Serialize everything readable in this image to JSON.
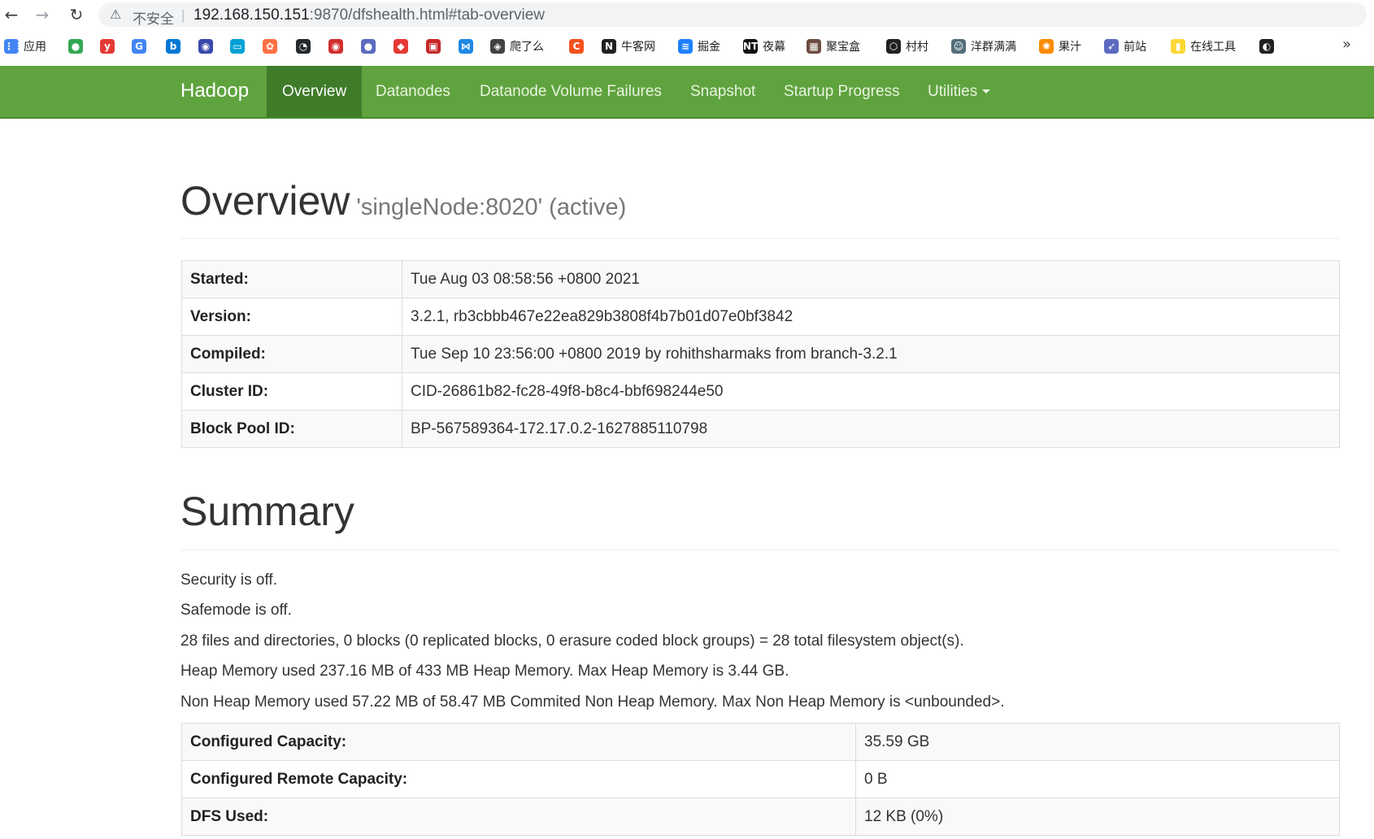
{
  "browser": {
    "insecure_label": "不安全",
    "url_host": "192.168.150.151",
    "url_rest": ":9870/dfshealth.html#tab-overview",
    "bookmarks": [
      {
        "label": "应用",
        "icon": "apps-grid-icon",
        "color": "#4285f4"
      },
      {
        "label": "",
        "icon": "maps-pin-icon",
        "color": "#34a853"
      },
      {
        "label": "",
        "icon": "y-icon",
        "color": "#e53935"
      },
      {
        "label": "",
        "icon": "translate-icon",
        "color": "#4285f4"
      },
      {
        "label": "",
        "icon": "bing-icon",
        "color": "#0078d4"
      },
      {
        "label": "",
        "icon": "globe-icon",
        "color": "#3949ab"
      },
      {
        "label": "",
        "icon": "bilibili-icon",
        "color": "#00a1d6"
      },
      {
        "label": "",
        "icon": "app-icon",
        "color": "#ff7043"
      },
      {
        "label": "",
        "icon": "github-icon",
        "color": "#24292e"
      },
      {
        "label": "",
        "icon": "circle-red-icon",
        "color": "#d32f2f"
      },
      {
        "label": "",
        "icon": "circle-blue-icon",
        "color": "#5c6bc0"
      },
      {
        "label": "",
        "icon": "fish-icon",
        "color": "#e53935"
      },
      {
        "label": "",
        "icon": "seal-icon",
        "color": "#c62828"
      },
      {
        "label": "",
        "icon": "vscode-icon",
        "color": "#1e88e5"
      },
      {
        "label": "爬了么",
        "icon": "layers-icon",
        "color": "#424242"
      },
      {
        "label": "",
        "icon": "c-icon",
        "color": "#f4511e"
      },
      {
        "label": "牛客网",
        "icon": "nowcoder-icon",
        "color": "#212121"
      },
      {
        "label": "掘金",
        "icon": "juejin-icon",
        "color": "#1e80ff"
      },
      {
        "label": "夜幕",
        "icon": "nt-icon",
        "color": "#111111"
      },
      {
        "label": "聚宝盒",
        "icon": "box-icon",
        "color": "#6d4c41"
      },
      {
        "label": "村村",
        "icon": "shield-icon",
        "color": "#212121"
      },
      {
        "label": "洋群满满",
        "icon": "sheep-icon",
        "color": "#546e7a"
      },
      {
        "label": "果汁",
        "icon": "orange-icon",
        "color": "#fb8c00"
      },
      {
        "label": "前站",
        "icon": "rocket-icon",
        "color": "#5c6bc0"
      },
      {
        "label": "在线工具",
        "icon": "folder-icon",
        "color": "#fdd835"
      },
      {
        "label": "",
        "icon": "globe-dark-icon",
        "color": "#212121"
      }
    ],
    "more_label": "»"
  },
  "navbar": {
    "brand": "Hadoop",
    "items": [
      "Overview",
      "Datanodes",
      "Datanode Volume Failures",
      "Snapshot",
      "Startup Progress",
      "Utilities"
    ],
    "accent": "#5fa33e",
    "active_bg": "#3f7c2a"
  },
  "overview": {
    "title": "Overview",
    "subtitle": "'singleNode:8020' (active)",
    "rows": [
      {
        "key": "Started:",
        "value": "Tue Aug 03 08:58:56 +0800 2021"
      },
      {
        "key": "Version:",
        "value": "3.2.1, rb3cbbb467e22ea829b3808f4b7b01d07e0bf3842"
      },
      {
        "key": "Compiled:",
        "value": "Tue Sep 10 23:56:00 +0800 2019 by rohithsharmaks from branch-3.2.1"
      },
      {
        "key": "Cluster ID:",
        "value": "CID-26861b82-fc28-49f8-b8c4-bbf698244e50"
      },
      {
        "key": "Block Pool ID:",
        "value": "BP-567589364-172.17.0.2-1627885110798"
      }
    ]
  },
  "summary": {
    "title": "Summary",
    "lines": [
      "Security is off.",
      "Safemode is off.",
      "28 files and directories, 0 blocks (0 replicated blocks, 0 erasure coded block groups) = 28 total filesystem object(s).",
      "Heap Memory used 237.16 MB of 433 MB Heap Memory. Max Heap Memory is 3.44 GB.",
      "Non Heap Memory used 57.22 MB of 58.47 MB Commited Non Heap Memory. Max Non Heap Memory is <unbounded>."
    ],
    "rows": [
      {
        "key": "Configured Capacity:",
        "value": "35.59 GB"
      },
      {
        "key": "Configured Remote Capacity:",
        "value": "0 B"
      },
      {
        "key": "DFS Used:",
        "value": "12 KB (0%)"
      }
    ]
  }
}
